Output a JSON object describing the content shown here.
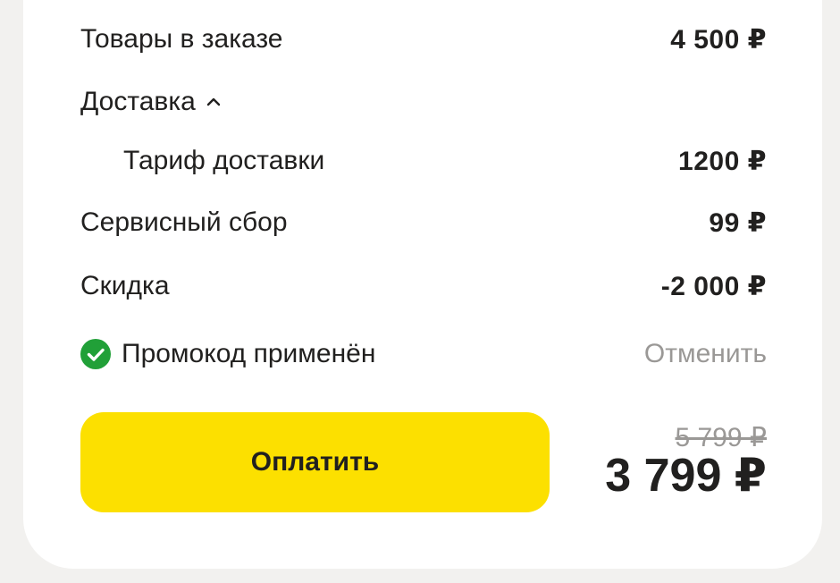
{
  "summary": {
    "items": {
      "label": "Товары в заказе",
      "value": "4 500 ₽"
    },
    "delivery": {
      "label": "Доставка"
    },
    "delivery_tariff": {
      "label": "Тариф доставки",
      "value": "1200 ₽"
    },
    "service_fee": {
      "label": "Сервисный сбор",
      "value": "99 ₽"
    },
    "discount": {
      "label": "Скидка",
      "value": "-2 000 ₽"
    },
    "promo": {
      "label": "Промокод применён",
      "cancel_label": "Отменить"
    }
  },
  "checkout": {
    "pay_label": "Оплатить",
    "old_price": "5 799 ₽",
    "total_price": "3 799 ₽"
  },
  "colors": {
    "accent_yellow": "#fce000",
    "success_green": "#21a038",
    "muted_text": "#9a9896"
  },
  "icons": {
    "delivery_toggle": "chevron-up-icon",
    "promo_status": "check-circle-icon"
  }
}
